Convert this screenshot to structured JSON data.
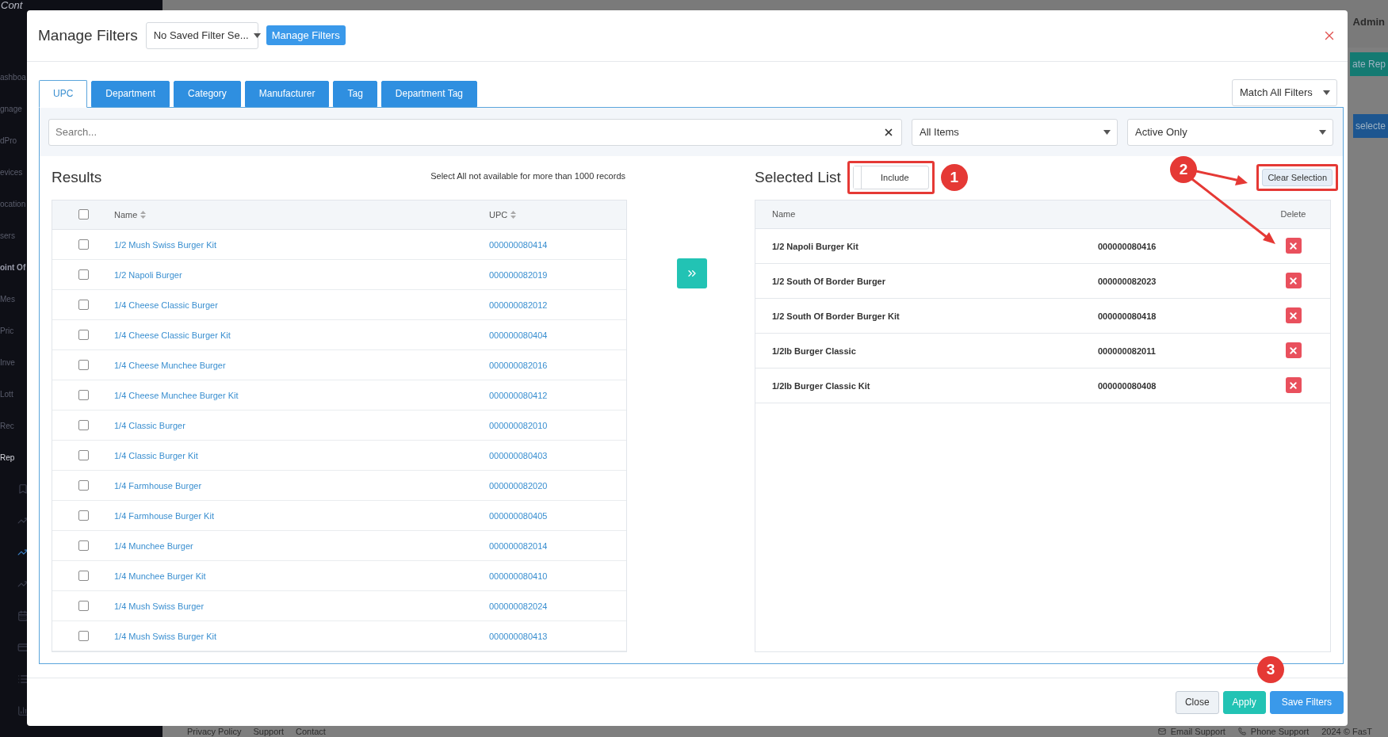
{
  "background": {
    "logo": "Cont",
    "user": "Admin",
    "sidebar_items": [
      {
        "label": "ashboa",
        "kind": "item",
        "selected": false
      },
      {
        "label": "gnage",
        "kind": "item",
        "selected": false
      },
      {
        "label": "dPro",
        "kind": "item",
        "selected": false
      },
      {
        "label": "evices",
        "kind": "item",
        "selected": false
      },
      {
        "label": "ocation",
        "kind": "item",
        "selected": false
      },
      {
        "label": "sers",
        "kind": "item",
        "selected": false
      },
      {
        "label": "oint Of",
        "kind": "header",
        "selected": false
      },
      {
        "label": "Mes",
        "kind": "item",
        "selected": false
      },
      {
        "label": "Pric",
        "kind": "item",
        "selected": false
      },
      {
        "label": "Inve",
        "kind": "item",
        "selected": false
      },
      {
        "label": "Lott",
        "kind": "item",
        "selected": false
      },
      {
        "label": "Rec",
        "kind": "item",
        "selected": false
      },
      {
        "label": "Rep",
        "kind": "item",
        "selected": true
      }
    ],
    "sidebar_icons": [
      {
        "selected": false
      },
      {
        "selected": false
      },
      {
        "selected": true
      },
      {
        "selected": false
      },
      {
        "selected": false
      },
      {
        "selected": false
      },
      {
        "selected": false
      },
      {
        "selected": false
      }
    ],
    "right_buttons": [
      {
        "label": "ate Rep",
        "kind": "teal"
      },
      {
        "label": "selecte",
        "kind": "blue"
      }
    ],
    "footer_links": [
      "Privacy Policy",
      "Support",
      "Contact"
    ],
    "footer_right": [
      "Email Support",
      "Phone Support",
      "2024 © FasT"
    ]
  },
  "modal": {
    "title": "Manage Filters",
    "saved_filter": {
      "value": "No Saved Filter Se..."
    },
    "manage_button": "Manage Filters",
    "tabs": [
      {
        "label": "UPC",
        "selected": true
      },
      {
        "label": "Department",
        "selected": false
      },
      {
        "label": "Category",
        "selected": false
      },
      {
        "label": "Manufacturer",
        "selected": false
      },
      {
        "label": "Tag",
        "selected": false
      },
      {
        "label": "Department Tag",
        "selected": false
      }
    ],
    "match_select": {
      "value": "Match All Filters"
    },
    "search": {
      "placeholder": "Search..."
    },
    "filters": [
      {
        "value": "All Items"
      },
      {
        "value": "Active Only"
      }
    ],
    "results": {
      "title": "Results",
      "note": "Select All not available for more than 1000 records",
      "select_all": {
        "checked": false
      },
      "columns": [
        "Name",
        "UPC"
      ],
      "rows": [
        {
          "name": "1/2 Mush Swiss Burger Kit",
          "upc": "000000080414",
          "checked": false
        },
        {
          "name": "1/2 Napoli Burger",
          "upc": "000000082019",
          "checked": false
        },
        {
          "name": "1/4 Cheese Classic Burger",
          "upc": "000000082012",
          "checked": false
        },
        {
          "name": "1/4 Cheese Classic Burger Kit",
          "upc": "000000080404",
          "checked": false
        },
        {
          "name": "1/4 Cheese Munchee Burger",
          "upc": "000000082016",
          "checked": false
        },
        {
          "name": "1/4 Cheese Munchee Burger Kit",
          "upc": "000000080412",
          "checked": false
        },
        {
          "name": "1/4 Classic Burger",
          "upc": "000000082010",
          "checked": false
        },
        {
          "name": "1/4 Classic Burger Kit",
          "upc": "000000080403",
          "checked": false
        },
        {
          "name": "1/4 Farmhouse Burger",
          "upc": "000000082020",
          "checked": false
        },
        {
          "name": "1/4 Farmhouse Burger Kit",
          "upc": "000000080405",
          "checked": false
        },
        {
          "name": "1/4 Munchee Burger",
          "upc": "000000082014",
          "checked": false
        },
        {
          "name": "1/4 Munchee Burger Kit",
          "upc": "000000080410",
          "checked": false
        },
        {
          "name": "1/4 Mush Swiss Burger",
          "upc": "000000082024",
          "checked": false
        },
        {
          "name": "1/4 Mush Swiss Burger Kit",
          "upc": "000000080413",
          "checked": false
        }
      ]
    },
    "selected_list": {
      "title": "Selected List",
      "mode": {
        "label": "Include",
        "on": false
      },
      "clear_button": "Clear Selection",
      "columns": [
        "Name",
        "Delete"
      ],
      "rows": [
        {
          "name": "1/2 Napoli Burger Kit",
          "upc": "000000080416"
        },
        {
          "name": "1/2 South Of Border Burger",
          "upc": "000000082023"
        },
        {
          "name": "1/2 South Of Border Burger Kit",
          "upc": "000000080418"
        },
        {
          "name": "1/2lb Burger Classic",
          "upc": "000000082011"
        },
        {
          "name": "1/2lb Burger Classic Kit",
          "upc": "000000080408"
        }
      ]
    },
    "footer_buttons": [
      {
        "label": "Close",
        "kind": "default"
      },
      {
        "label": "Apply",
        "kind": "apply"
      },
      {
        "label": "Save Filters",
        "kind": "primary"
      }
    ]
  },
  "annotations": [
    {
      "label": "1"
    },
    {
      "label": "2"
    },
    {
      "label": "3"
    }
  ]
}
